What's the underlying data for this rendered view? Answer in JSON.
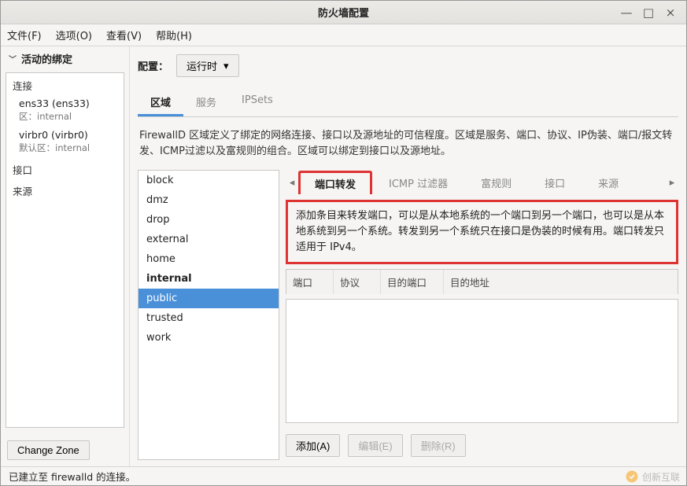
{
  "window": {
    "title": "防火墙配置"
  },
  "menu": {
    "file": "文件(F)",
    "options": "选项(O)",
    "view": "查看(V)",
    "help": "帮助(H)"
  },
  "sidebar": {
    "title": "活动的绑定",
    "sections": {
      "connections": "连接",
      "interfaces": "接口",
      "sources": "来源"
    },
    "conns": [
      {
        "name": "ens33 (ens33)",
        "zone_label": "区：internal"
      },
      {
        "name": "virbr0 (virbr0)",
        "zone_label": "默认区：internal"
      }
    ],
    "change_zone": "Change Zone"
  },
  "config": {
    "label": "配置：",
    "mode": "运行时"
  },
  "tabs": {
    "zones": "区域",
    "services": "服务",
    "ipsets": "IPSets"
  },
  "zone_desc": "FirewallD 区域定义了绑定的网络连接、接口以及源地址的可信程度。区域是服务、端口、协议、IP伪装、端口/报文转发、ICMP过滤以及富规则的组合。区域可以绑定到接口以及源地址。",
  "zonelist": [
    "block",
    "dmz",
    "drop",
    "external",
    "home",
    "internal",
    "public",
    "trusted",
    "work"
  ],
  "zonelist_bold": "internal",
  "zonelist_selected": "public",
  "subtabs": {
    "port_forward": "端口转发",
    "icmp_filter": "ICMP 过滤器",
    "rich_rules": "富规则",
    "interfaces": "接口",
    "sources": "来源"
  },
  "subdesc": "添加条目来转发端口，可以是从本地系统的一个端口到另一个端口，也可以是从本地系统到另一个系统。转发到另一个系统只在接口是伪装的时候有用。端口转发只适用于 IPv4。",
  "columns": {
    "port": "端口",
    "proto": "协议",
    "dest_port": "目的端口",
    "dest_addr": "目的地址"
  },
  "buttons": {
    "add": "添加(A)",
    "edit": "编辑(E)",
    "delete": "删除(R)"
  },
  "status": "已建立至 firewalld 的连接。",
  "watermark": "创新互联"
}
